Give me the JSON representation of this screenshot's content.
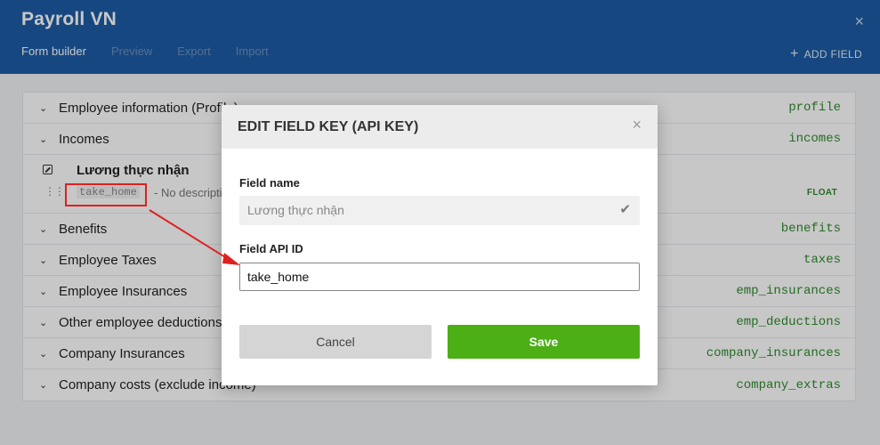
{
  "header": {
    "title": "Payroll VN",
    "tabs": [
      "Form builder",
      "Preview",
      "Export",
      "Import"
    ],
    "add_field_label": "ADD FIELD",
    "close": "×"
  },
  "sections": [
    {
      "label": "Employee information (Profile)",
      "key": "profile"
    },
    {
      "label": "Incomes",
      "key": "incomes"
    },
    {
      "label": "Benefits",
      "key": "benefits"
    },
    {
      "label": "Employee Taxes",
      "key": "taxes"
    },
    {
      "label": "Employee Insurances",
      "key": "emp_insurances"
    },
    {
      "label": "Other employee deductions",
      "key": "emp_deductions"
    },
    {
      "label": "Company Insurances",
      "key": "company_insurances"
    },
    {
      "label": "Company costs (exclude income)",
      "key": "company_extras"
    }
  ],
  "field": {
    "name": "Lương thực nhận",
    "key": "take_home",
    "description": "- No description",
    "type": "FLOAT"
  },
  "modal": {
    "title": "EDIT FIELD KEY (API KEY)",
    "close": "×",
    "field_name_label": "Field name",
    "field_name_value": "Lương thực nhận",
    "api_label": "Field API ID",
    "api_value": "take_home",
    "cancel_label": "Cancel",
    "save_label": "Save"
  },
  "colors": {
    "header": "#1d5ba4",
    "key_green": "#2e8b2e",
    "save_green": "#4caf16",
    "annotation_red": "#e02020"
  }
}
